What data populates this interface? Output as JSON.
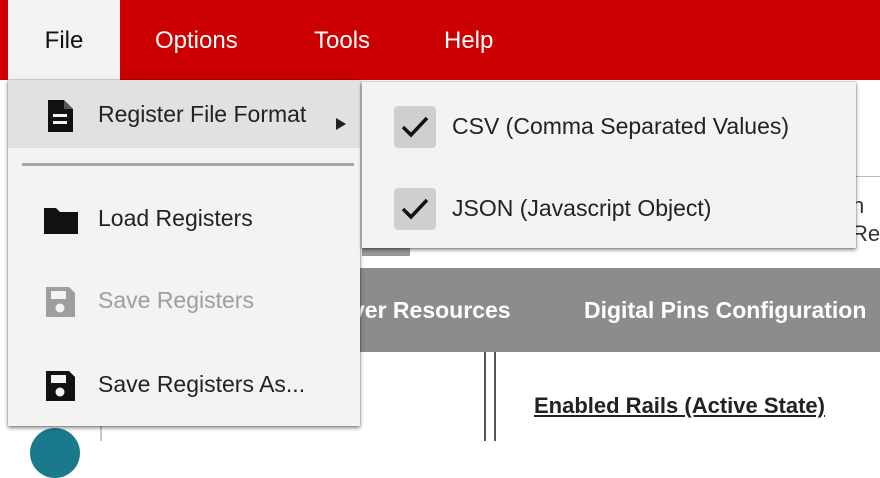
{
  "menubar": {
    "items": [
      {
        "label": "File"
      },
      {
        "label": "Options"
      },
      {
        "label": "Tools"
      },
      {
        "label": "Help"
      }
    ]
  },
  "file_menu": {
    "register_file_format": {
      "label": "Register File Format",
      "icon": "document-icon"
    },
    "load_registers": {
      "label": "Load Registers",
      "icon": "folder-icon"
    },
    "save_registers": {
      "label": "Save Registers",
      "icon": "save-icon",
      "disabled": true
    },
    "save_registers_as": {
      "label": "Save Registers As...",
      "icon": "save-icon"
    }
  },
  "submenu": {
    "items": [
      {
        "label": "CSV (Comma Separated Values)",
        "checked": true
      },
      {
        "label": "JSON (Javascript Object)",
        "checked": true
      }
    ]
  },
  "background": {
    "tabs": [
      {
        "label": "ver Resources"
      },
      {
        "label": "Digital Pins Configuration"
      }
    ],
    "heading": "Enabled Rails (Active State)",
    "cut_text_line1": "n",
    "cut_text_line2": "Re"
  },
  "colors": {
    "menubar": "#cc0000",
    "tabbar": "#8c8c8c",
    "menu_bg": "#f3f3f3",
    "highlight": "#e1e1e1"
  }
}
